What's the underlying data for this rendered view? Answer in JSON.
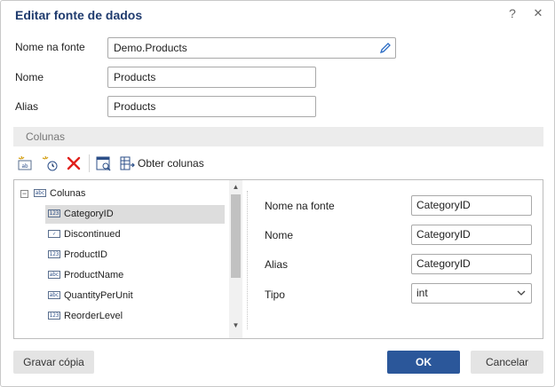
{
  "dialog": {
    "title": "Editar fonte de dados",
    "help_label": "?",
    "close_label": "✕"
  },
  "form": {
    "source_name_label": "Nome na fonte",
    "source_name_value": "Demo.Products",
    "name_label": "Nome",
    "name_value": "Products",
    "alias_label": "Alias",
    "alias_value": "Products"
  },
  "columns_section": {
    "title": "Colunas"
  },
  "toolbar": {
    "get_columns_label": "Obter colunas",
    "icons": [
      "new-column-icon",
      "calculated-column-icon",
      "delete-icon",
      "preview-icon",
      "get-columns-icon"
    ]
  },
  "tree": {
    "root_label": "Colunas",
    "expander": "−",
    "items": [
      {
        "label": "CategoryID",
        "type_icon": "123"
      },
      {
        "label": "Discontinued",
        "type_icon": "✓"
      },
      {
        "label": "ProductID",
        "type_icon": "123"
      },
      {
        "label": "ProductName",
        "type_icon": "abc"
      },
      {
        "label": "QuantityPerUnit",
        "type_icon": "abc"
      },
      {
        "label": "ReorderLevel",
        "type_icon": "123"
      }
    ],
    "selected_index": 0,
    "scroll_up": "▲",
    "scroll_down": "▼"
  },
  "properties": {
    "source_name_label": "Nome na fonte",
    "source_name_value": "CategoryID",
    "name_label": "Nome",
    "name_value": "CategoryID",
    "alias_label": "Alias",
    "alias_value": "CategoryID",
    "type_label": "Tipo",
    "type_value": "int"
  },
  "footer": {
    "copy_label": "Gravar cópia",
    "ok_label": "OK",
    "cancel_label": "Cancelar"
  },
  "colors": {
    "title": "#1f3b6e",
    "primary_button": "#2b579a",
    "delete_icon": "#e0201b",
    "selection": "#dddddd"
  }
}
